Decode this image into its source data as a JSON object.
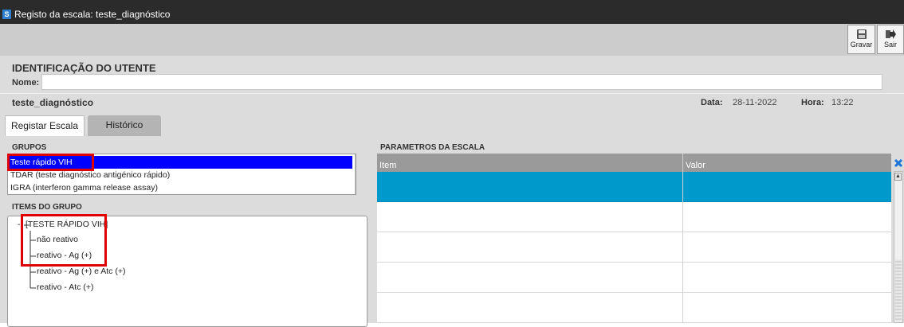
{
  "window": {
    "title": "Registo da escala: teste_diagnóstico",
    "app_icon_glyph": "S"
  },
  "toolbar": {
    "save_label": "Gravar",
    "exit_label": "Sair"
  },
  "patient": {
    "section_title": "IDENTIFICAÇÃO DO UTENTE",
    "name_label": "Nome:",
    "name_value": ""
  },
  "scale": {
    "name": "teste_diagnóstico",
    "date_label": "Data:",
    "date_value": "28-11-2022",
    "time_label": "Hora:",
    "time_value": "13:22"
  },
  "tabs": [
    {
      "label": "Registar Escala",
      "active": true
    },
    {
      "label": "Histórico",
      "active": false
    }
  ],
  "groups": {
    "header": "GRUPOS",
    "items": [
      {
        "label": "Teste rápido VIH",
        "selected": true
      },
      {
        "label": "TDAR (teste diagnóstico antigénico rápido)",
        "selected": false
      },
      {
        "label": "IGRA (interferon gamma release assay)",
        "selected": false
      }
    ]
  },
  "group_items": {
    "header": "ITEMS DO GRUPO",
    "root": "[TESTE RÁPIDO VIH]",
    "root_toggle": "-",
    "children": [
      "não reativo",
      "reativo - Ag (+)",
      "reativo - Ag (+) e Atc (+)",
      "reativo - Atc (+)"
    ]
  },
  "parameters": {
    "header": "PARAMETROS DA ESCALA",
    "columns": [
      "Item",
      "Valor"
    ],
    "rows": [
      {
        "item": "",
        "value": "",
        "selected": true
      },
      {
        "item": "",
        "value": "",
        "selected": false
      },
      {
        "item": "",
        "value": "",
        "selected": false
      },
      {
        "item": "",
        "value": "",
        "selected": false
      },
      {
        "item": "",
        "value": "",
        "selected": false
      }
    ]
  },
  "colors": {
    "title_bar": "#2b2b2b",
    "selected_list": "#0000ff",
    "selected_grid_row": "#0099cc",
    "highlight": "#e00000",
    "close_icon": "#1a73d9"
  },
  "icons": {
    "save": "floppy-disk-icon",
    "exit": "exit-arrow-icon",
    "close": "close-icon",
    "scroll_up": "scroll-up-icon",
    "scroll_down": "scroll-down-icon"
  }
}
